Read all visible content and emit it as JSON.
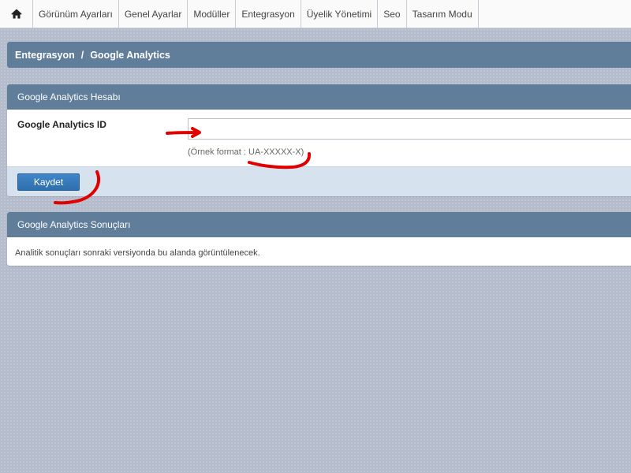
{
  "nav": {
    "home_icon": "home-icon",
    "items": [
      {
        "label": "Görünüm Ayarları"
      },
      {
        "label": "Genel Ayarlar"
      },
      {
        "label": "Modüller"
      },
      {
        "label": "Entegrasyon"
      },
      {
        "label": "Üyelik Yönetimi"
      },
      {
        "label": "Seo"
      },
      {
        "label": "Tasarım Modu"
      }
    ]
  },
  "breadcrumb": {
    "parent": "Entegrasyon",
    "separator": "/",
    "current": "Google Analytics"
  },
  "account_panel": {
    "title": "Google Analytics Hesabı",
    "field_label": "Google Analytics ID",
    "field_value": "",
    "help_text": "(Örnek format : UA-XXXXX-X)",
    "save_label": "Kaydet"
  },
  "results_panel": {
    "title": "Google Analytics Sonuçları",
    "message": "Analitik sonuçları sonraki versiyonda bu alanda görüntülenecek."
  },
  "colors": {
    "header_bar": "#607d99",
    "footer_bar": "#d6e2ee",
    "button": "#3277b8",
    "background": "#b4bccc",
    "annotation": "#e00000"
  }
}
